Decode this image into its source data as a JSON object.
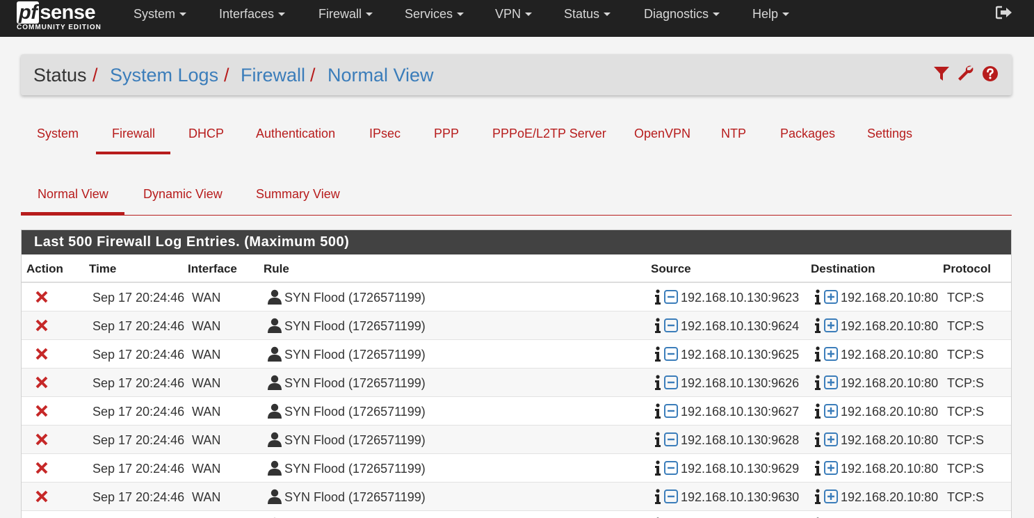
{
  "brand": {
    "name_pf": "pf",
    "name_rest": "sense",
    "edition": "COMMUNITY EDITION"
  },
  "nav": {
    "items": [
      "System",
      "Interfaces",
      "Firewall",
      "Services",
      "VPN",
      "Status",
      "Diagnostics",
      "Help"
    ],
    "logout_icon": "logout-icon"
  },
  "breadcrumb": {
    "items": [
      "Status",
      "System Logs",
      "Firewall",
      "Normal View"
    ],
    "separator": "/"
  },
  "toolbar": {
    "icons": [
      "filter-icon",
      "wrench-icon",
      "help-icon"
    ]
  },
  "tabs": {
    "items": [
      "System",
      "Firewall",
      "DHCP",
      "Authentication",
      "IPsec",
      "PPP",
      "PPPoE/L2TP Server",
      "OpenVPN",
      "NTP",
      "Packages",
      "Settings"
    ],
    "active": "Firewall"
  },
  "subtabs": {
    "items": [
      "Normal View",
      "Dynamic View",
      "Summary View"
    ],
    "active": "Normal View"
  },
  "log": {
    "heading": "Last 500 Firewall Log Entries. (Maximum 500)",
    "columns": [
      "Action",
      "Time",
      "Interface",
      "Rule",
      "Source",
      "Destination",
      "Protocol"
    ],
    "rows": [
      {
        "action": "block-icon",
        "time": "Sep 17 20:24:46",
        "interface": "WAN",
        "rule": "SYN Flood (1726571199)",
        "source": "192.168.10.130:9623",
        "destination": "192.168.20.10:80",
        "protocol": "TCP:S"
      },
      {
        "action": "block-icon",
        "time": "Sep 17 20:24:46",
        "interface": "WAN",
        "rule": "SYN Flood (1726571199)",
        "source": "192.168.10.130:9624",
        "destination": "192.168.20.10:80",
        "protocol": "TCP:S"
      },
      {
        "action": "block-icon",
        "time": "Sep 17 20:24:46",
        "interface": "WAN",
        "rule": "SYN Flood (1726571199)",
        "source": "192.168.10.130:9625",
        "destination": "192.168.20.10:80",
        "protocol": "TCP:S"
      },
      {
        "action": "block-icon",
        "time": "Sep 17 20:24:46",
        "interface": "WAN",
        "rule": "SYN Flood (1726571199)",
        "source": "192.168.10.130:9626",
        "destination": "192.168.20.10:80",
        "protocol": "TCP:S"
      },
      {
        "action": "block-icon",
        "time": "Sep 17 20:24:46",
        "interface": "WAN",
        "rule": "SYN Flood (1726571199)",
        "source": "192.168.10.130:9627",
        "destination": "192.168.20.10:80",
        "protocol": "TCP:S"
      },
      {
        "action": "block-icon",
        "time": "Sep 17 20:24:46",
        "interface": "WAN",
        "rule": "SYN Flood (1726571199)",
        "source": "192.168.10.130:9628",
        "destination": "192.168.20.10:80",
        "protocol": "TCP:S"
      },
      {
        "action": "block-icon",
        "time": "Sep 17 20:24:46",
        "interface": "WAN",
        "rule": "SYN Flood (1726571199)",
        "source": "192.168.10.130:9629",
        "destination": "192.168.20.10:80",
        "protocol": "TCP:S"
      },
      {
        "action": "block-icon",
        "time": "Sep 17 20:24:46",
        "interface": "WAN",
        "rule": "SYN Flood (1726571199)",
        "source": "192.168.10.130:9630",
        "destination": "192.168.20.10:80",
        "protocol": "TCP:S"
      }
    ]
  },
  "colors": {
    "navbar": "#212121",
    "accent_red": "#b71c1c",
    "link_blue": "#3b7dba",
    "panel_heading": "#424242"
  }
}
